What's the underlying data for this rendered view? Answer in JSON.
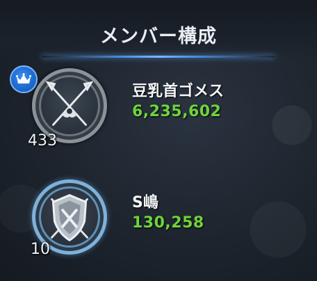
{
  "header": {
    "title": "メンバー構成"
  },
  "members": [
    {
      "name": "豆乳首ゴメス",
      "power": "6,235,602",
      "level": "433",
      "leader": true,
      "emblem_icon": "crossed-swords-emblem-icon"
    },
    {
      "name": "S嶋",
      "power": "130,258",
      "level": "10",
      "leader": false,
      "emblem_icon": "shield-swords-emblem-icon"
    }
  ],
  "colors": {
    "power_text": "#6fd43b",
    "accent_line": "#4a8fe0",
    "leader_badge": "#1763c8"
  }
}
